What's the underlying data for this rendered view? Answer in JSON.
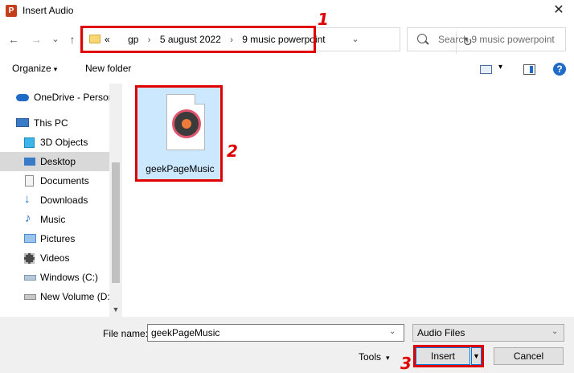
{
  "window": {
    "title": "Insert Audio",
    "app_icon_letter": "P",
    "close": "✕"
  },
  "nav": {
    "back": "←",
    "forward": "→",
    "recent": "⌄",
    "up": "↑",
    "refresh": "↻"
  },
  "address": {
    "prefix": "«",
    "crumbs": [
      "gp",
      "5 august 2022",
      "9 music powerpoint"
    ],
    "separator": "›",
    "dropdown": "⌄"
  },
  "search": {
    "placeholder": "Search 9 music powerpoint"
  },
  "toolbar": {
    "organize": "Organize",
    "caret": "▾",
    "new_folder": "New folder",
    "help": "?"
  },
  "sidebar": {
    "items": [
      {
        "label": "OneDrive - Person",
        "icon": "cloud-icon",
        "color": "#1e6cc8"
      },
      {
        "label": "This PC",
        "icon": "computer-icon",
        "color": "#3a7bc8"
      },
      {
        "label": "3D Objects",
        "icon": "cube-icon",
        "color": "#3cb6e8"
      },
      {
        "label": "Desktop",
        "icon": "desktop-icon",
        "color": "#3a7bc8",
        "selected": true
      },
      {
        "label": "Documents",
        "icon": "document-icon",
        "color": "#8a8a8a"
      },
      {
        "label": "Downloads",
        "icon": "download-icon",
        "color": "#1e6cc8"
      },
      {
        "label": "Music",
        "icon": "music-icon",
        "color": "#1e6cc8"
      },
      {
        "label": "Pictures",
        "icon": "pictures-icon",
        "color": "#4a8ad0"
      },
      {
        "label": "Videos",
        "icon": "video-icon",
        "color": "#4a4a4a"
      },
      {
        "label": "Windows (C:)",
        "icon": "drive-icon",
        "color": "#7a9ab8"
      },
      {
        "label": "New Volume (D:",
        "icon": "drive-icon",
        "color": "#8a8a8a"
      }
    ],
    "scroll_down": "▼"
  },
  "files": [
    {
      "name": "geekPageMusic",
      "icon": "music-file-icon"
    }
  ],
  "footer": {
    "filename_label": "File name:",
    "filename_value": "geekPageMusic",
    "filetype": "Audio Files",
    "dropdown": "⌄",
    "tools": "Tools",
    "insert": "Insert",
    "split_caret": "▼",
    "cancel": "Cancel"
  },
  "annotations": [
    "1",
    "2",
    "3"
  ],
  "colors": {
    "accent": "#0078d7",
    "annotation": "#e00000",
    "selection": "#cce8ff"
  }
}
